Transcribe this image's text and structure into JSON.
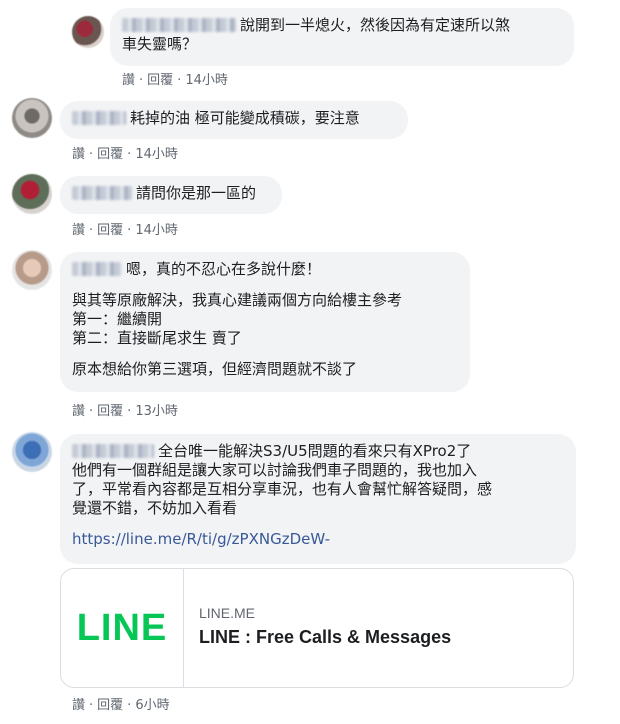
{
  "comments": [
    {
      "text_lines": [
        "說開到一半熄火，然後因為有定速所以煞",
        "車失靈嗎？"
      ],
      "actions": {
        "like": "讚",
        "reply": "回覆",
        "time": "14小時"
      }
    },
    {
      "text": "耗掉的油 極可能變成積碳，要注意",
      "actions": {
        "like": "讚",
        "reply": "回覆",
        "time": "14小時"
      }
    },
    {
      "text": "請問你是那一區的",
      "actions": {
        "like": "讚",
        "reply": "回覆",
        "time": "14小時"
      }
    },
    {
      "lines": [
        "嗯，真的不忍心在多說什麼！",
        "與其等原廠解決，我真心建議兩個方向給樓主參考",
        "第一：繼續開",
        "第二：直接斷尾求生 賣了",
        "原本想給你第三選項，但經濟問題就不談了"
      ],
      "actions": {
        "like": "讚",
        "reply": "回覆",
        "time": "13小時"
      }
    },
    {
      "lines": [
        "全台唯一能解決S3/U5問題的看來只有XPro2了",
        "他們有一個群組是讓大家可以討論我們車子問題的，我也加入",
        "了，平常看內容都是互相分享車況，也有人會幫忙解答疑問，感",
        "覺還不錯，不妨加入看看"
      ],
      "link": "https://line.me/R/ti/g/zPXNGzDeW-",
      "preview": {
        "logo": "LINE",
        "domain": "LINE.ME",
        "title": "LINE : Free Calls & Messages"
      },
      "actions": {
        "like": "讚",
        "reply": "回覆",
        "time": "6小時"
      }
    }
  ],
  "colors": {
    "bubble": "#f2f3f5",
    "link": "#385898",
    "line_green": "#06c755",
    "meta": "#606770"
  }
}
